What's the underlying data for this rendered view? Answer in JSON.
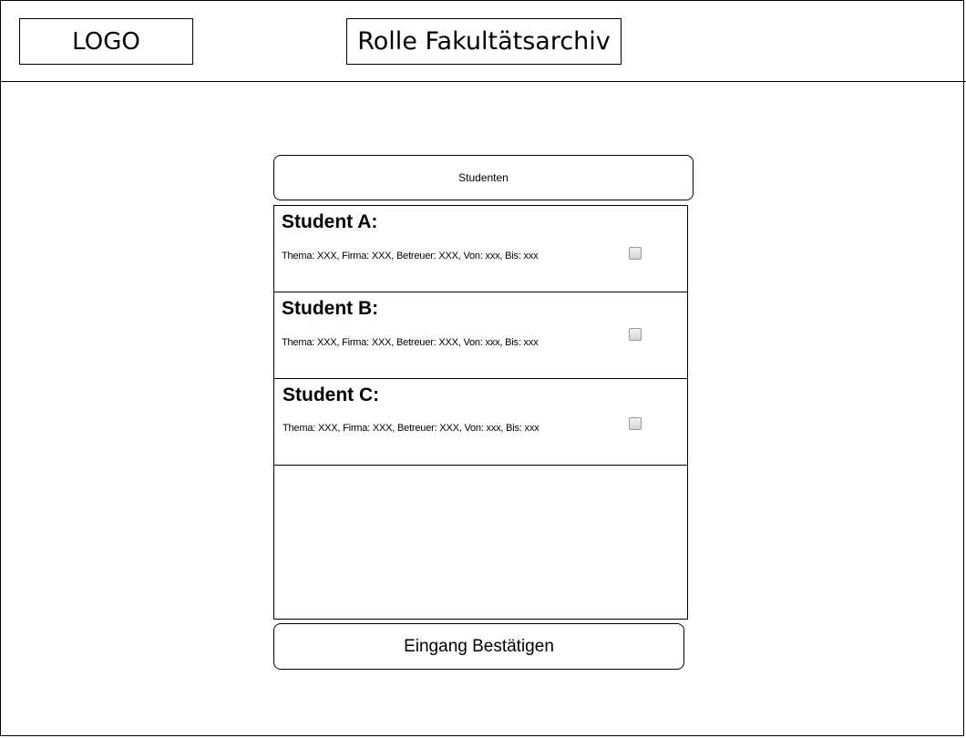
{
  "header": {
    "logo": "LOGO",
    "role_title": "Rolle Fakultätsarchiv"
  },
  "students_header": {
    "label": "Studenten"
  },
  "students": [
    {
      "title": "Student A:",
      "details": "Thema: XXX, Firma: XXX, Betreuer: XXX, Von: xxx, Bis: xxx",
      "checked": false
    },
    {
      "title": "Student B:",
      "details": "Thema: XXX, Firma: XXX, Betreuer: XXX, Von: xxx, Bis: xxx",
      "checked": false
    },
    {
      "title": "Student C:",
      "details": "Thema: XXX, Firma: XXX, Betreuer: XXX, Von: xxx, Bis: xxx",
      "checked": false
    }
  ],
  "confirm_button": {
    "label": "Eingang Bestätigen"
  }
}
